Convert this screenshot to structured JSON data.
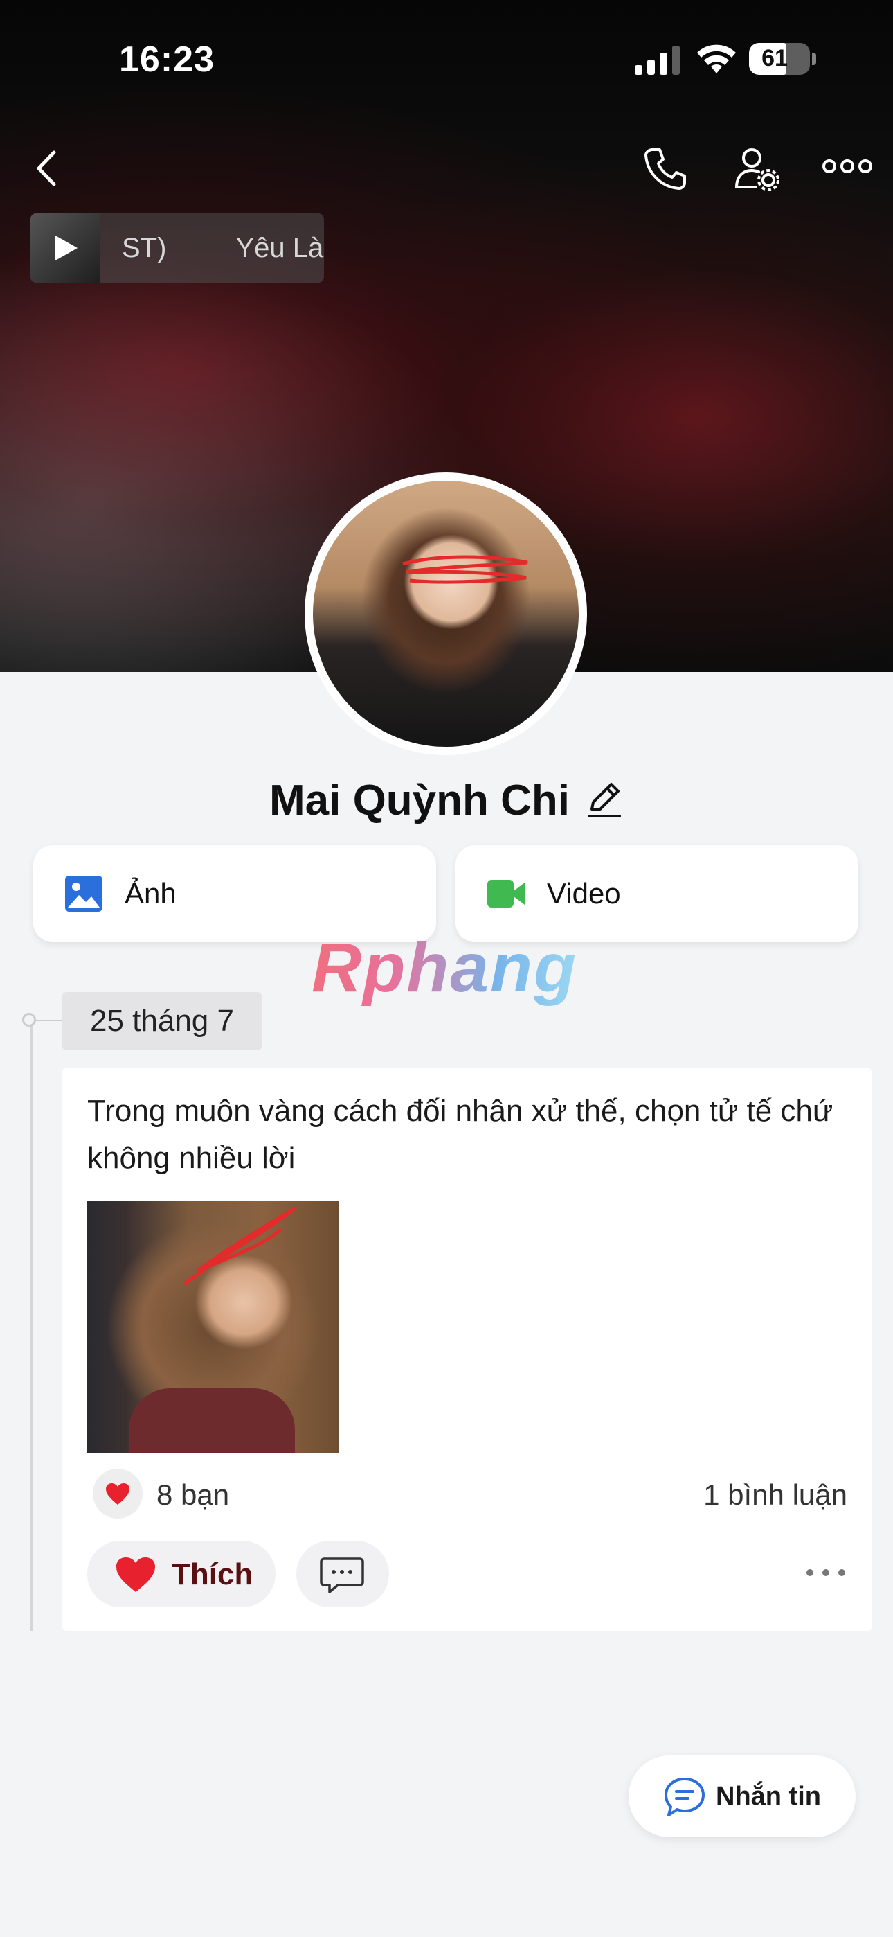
{
  "status_bar": {
    "time": "16:23",
    "battery": "61",
    "battery_level": 0.61
  },
  "header": {
    "music": {
      "text_1": "ST)",
      "text_2": "Yêu Là"
    }
  },
  "profile": {
    "name": "Mai Quỳnh Chi"
  },
  "media": {
    "photos_label": "Ảnh",
    "videos_label": "Video"
  },
  "watermark": "Rphang",
  "timeline": {
    "date": "25 tháng 7",
    "post": {
      "text": "Trong muôn vàng cách đối nhân xử thế, chọn tử tế chứ không nhiều lời",
      "likes": "8 bạn",
      "comments": "1 bình luận",
      "like_label": "Thích"
    }
  },
  "message_button": {
    "label": "Nhắn tin"
  },
  "colors": {
    "accent_blue": "#2a6fdb",
    "video_green": "#3fb950",
    "heart_red": "#e8212e",
    "like_text": "#5a0f12"
  }
}
